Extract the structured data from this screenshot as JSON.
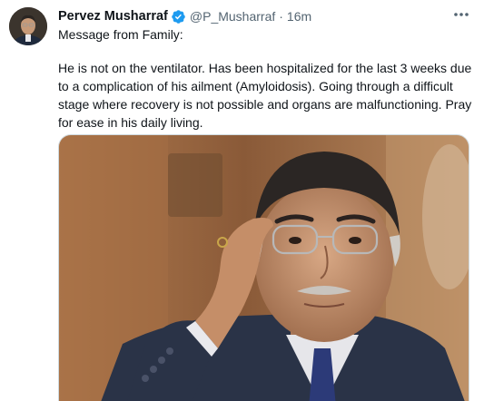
{
  "tweet": {
    "author_name": "Pervez Musharraf",
    "handle": "@P_Musharraf",
    "separator": "·",
    "timestamp": "16m",
    "intro": "Message from Family:",
    "body": "He is not on the ventilator. Has been hospitalized for the last 3 weeks due\nto a complication of his ailment (Amyloidosis).  Going through a difficult\nstage where recovery is not possible and organs are malfunctioning. Pray\nfor ease in his daily living.",
    "icons": {
      "verified": "verified-badge-icon",
      "more": "more-options-icon"
    },
    "colors": {
      "verified_blue": "#1d9bf0",
      "secondary_text": "#536471",
      "primary_text": "#0f1419"
    }
  }
}
